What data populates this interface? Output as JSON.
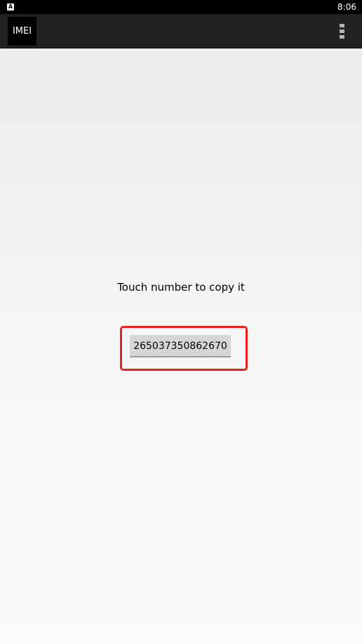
{
  "status_bar": {
    "notification_icon": "A",
    "time": "8:06"
  },
  "action_bar": {
    "app_icon_label": "IMEI",
    "overflow_icon": "overflow-menu-icon"
  },
  "main": {
    "instruction": "Touch number to copy it",
    "imei_number": "265037350862670"
  },
  "colors": {
    "status_bar": "#000000",
    "action_bar": "#222222",
    "highlight": "#e8201a",
    "button_bg": "#d6d6d6"
  }
}
